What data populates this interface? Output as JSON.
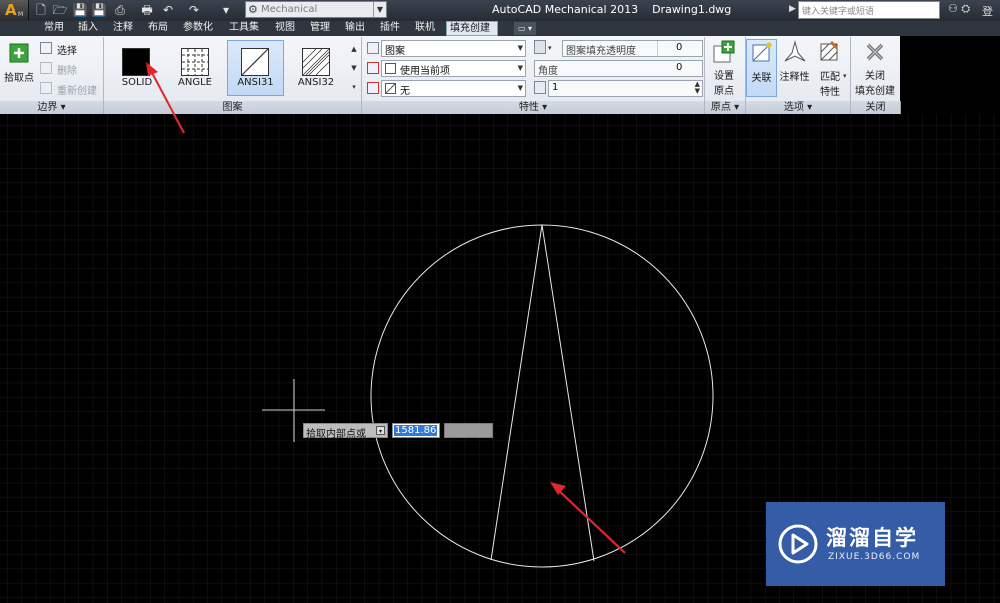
{
  "titlebar": {
    "logo_letter": "A",
    "logo_sub": "M",
    "workspace": "Mechanical",
    "title": "AutoCAD Mechanical 2013    Drawing1.dwg",
    "search_placeholder": "键入关键字或短语",
    "login_label": "登"
  },
  "tabs": [
    "常用",
    "插入",
    "注释",
    "布局",
    "参数化",
    "工具集",
    "视图",
    "管理",
    "输出",
    "插件",
    "联机",
    "填充创建"
  ],
  "active_tab": "填充创建",
  "ribbon": {
    "boundary": {
      "pick_points": "拾取点",
      "select": "选择",
      "remove": "删除",
      "recreate": "重新创建",
      "panel_label": "边界 ▾"
    },
    "pattern": {
      "items": [
        "SOLID",
        "ANGLE",
        "ANSI31",
        "ANSI32"
      ],
      "selected": "ANSI31",
      "panel_label": "图案"
    },
    "properties": {
      "type_value": "图案",
      "color_value": "使用当前项",
      "background_value": "无",
      "transparency_label": "图案填充透明度",
      "transparency_value": "0",
      "angle_label": "角度",
      "angle_value": "0",
      "scale_value": "1",
      "panel_label": "特性 ▾"
    },
    "origin": {
      "set_origin_l1": "设置",
      "set_origin_l2": "原点",
      "panel_label": "原点 ▾"
    },
    "options": {
      "associative": "关联",
      "annotative": "注释性",
      "match_l1": "匹配",
      "match_l2": "特性",
      "panel_label": "选项 ▾"
    },
    "close": {
      "label_l1": "关闭",
      "label_l2": "填充创建",
      "panel_label": "关闭"
    }
  },
  "canvas": {
    "prompt": "拾取内部点或",
    "input_value": "1581.86"
  },
  "watermark": {
    "title": "溜溜自学",
    "url": "ZIXUE.3D66.COM"
  },
  "colors": {
    "accent_red": "#e0282c",
    "selection_blue": "#3278d6",
    "ribbon_bg": "#eef1f5",
    "canvas_bg": "#000000",
    "grid": "#2a2a2a",
    "watermark": "#3a64b4"
  }
}
